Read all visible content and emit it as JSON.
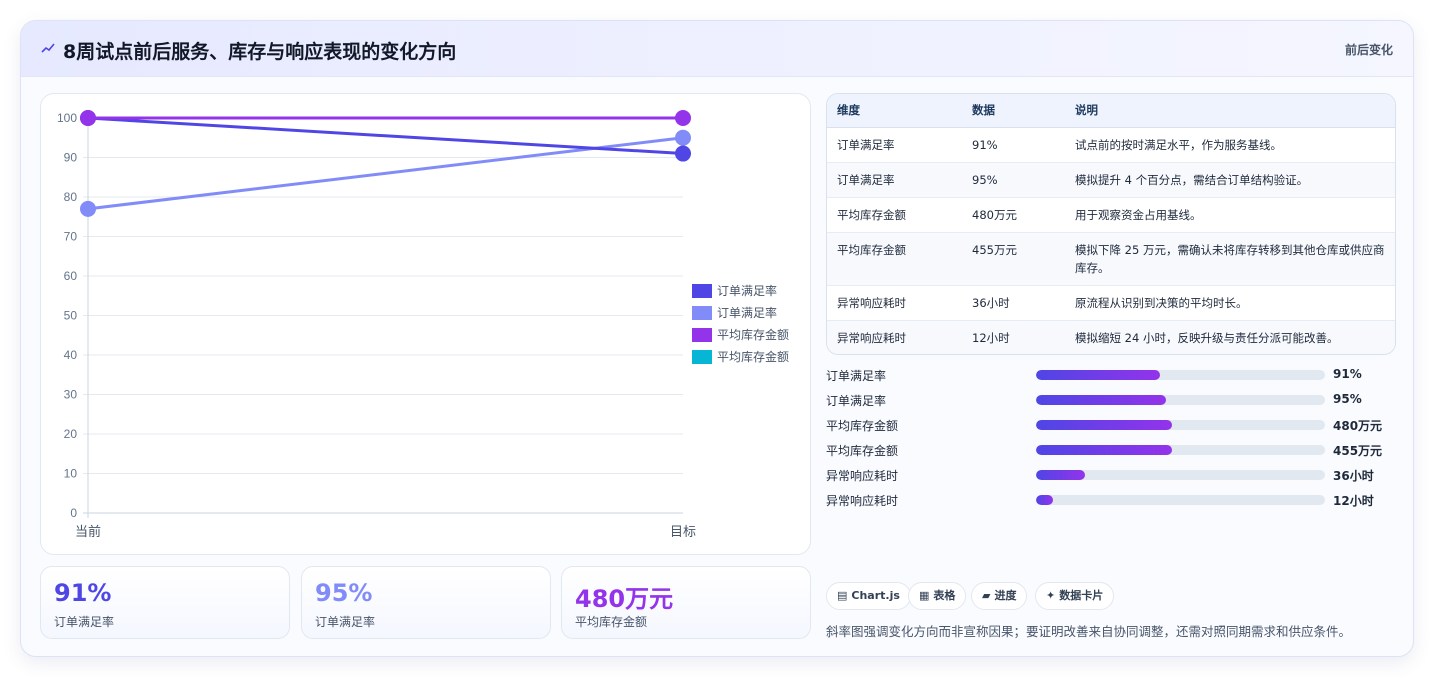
{
  "header": {
    "title": "8周试点前后服务、库存与响应表现的变化方向",
    "badge": "前后变化",
    "icon": "trend-line-icon"
  },
  "chart_data": {
    "type": "line",
    "categories": [
      "当前",
      "目标"
    ],
    "ylim": [
      0,
      100
    ],
    "yticks": [
      0,
      10,
      20,
      30,
      40,
      50,
      60,
      70,
      80,
      90,
      100
    ],
    "grid": true,
    "legend_position": "right",
    "series": [
      {
        "name": "订单满足率",
        "values": [
          100,
          91
        ],
        "color": "#4f46e5"
      },
      {
        "name": "订单满足率",
        "values": [
          77,
          95
        ],
        "color": "#818cf8"
      },
      {
        "name": "平均库存金额",
        "values": [
          100,
          100
        ],
        "color": "#9333ea"
      },
      {
        "name": "平均库存金额",
        "values": [],
        "color": "#06b6d4"
      }
    ]
  },
  "kpis": [
    {
      "value": "91%",
      "label": "订单满足率",
      "color": "#4f46e5"
    },
    {
      "value": "95%",
      "label": "订单满足率",
      "color": "#818cf8"
    },
    {
      "value": "480万元",
      "label": "平均库存金额",
      "color": "#9333ea"
    }
  ],
  "table": {
    "headers": [
      "维度",
      "数据",
      "说明"
    ],
    "rows": [
      {
        "dim": "订单满足率",
        "data": "91%",
        "desc": "试点前的按时满足水平，作为服务基线。"
      },
      {
        "dim": "订单满足率",
        "data": "95%",
        "desc": "模拟提升 4 个百分点，需结合订单结构验证。"
      },
      {
        "dim": "平均库存金额",
        "data": "480万元",
        "desc": "用于观察资金占用基线。"
      },
      {
        "dim": "平均库存金额",
        "data": "455万元",
        "desc": "模拟下降 25 万元，需确认未将库存转移到其他仓库或供应商库存。"
      },
      {
        "dim": "异常响应耗时",
        "data": "36小时",
        "desc": "原流程从识别到决策的平均时长。"
      },
      {
        "dim": "异常响应耗时",
        "data": "12小时",
        "desc": "模拟缩短 24 小时，反映升级与责任分派可能改善。"
      }
    ]
  },
  "progress": [
    {
      "label": "订单满足率",
      "value": "91%",
      "fraction": 0.43
    },
    {
      "label": "订单满足率",
      "value": "95%",
      "fraction": 0.45
    },
    {
      "label": "平均库存金额",
      "value": "480万元",
      "fraction": 0.47
    },
    {
      "label": "平均库存金额",
      "value": "455万元",
      "fraction": 0.47
    },
    {
      "label": "异常响应耗时",
      "value": "36小时",
      "fraction": 0.17
    },
    {
      "label": "异常响应耗时",
      "value": "12小时",
      "fraction": 0.06
    }
  ],
  "tags": [
    {
      "icon": "▤",
      "label": "Chart.js"
    },
    {
      "icon": "▦",
      "label": "表格"
    },
    {
      "icon": "▰",
      "label": "进度"
    },
    {
      "icon": "✦",
      "label": "数据卡片"
    }
  ],
  "note": "斜率图强调变化方向而非宣称因果；要证明改善来自协同调整，还需对照同期需求和供应条件。"
}
